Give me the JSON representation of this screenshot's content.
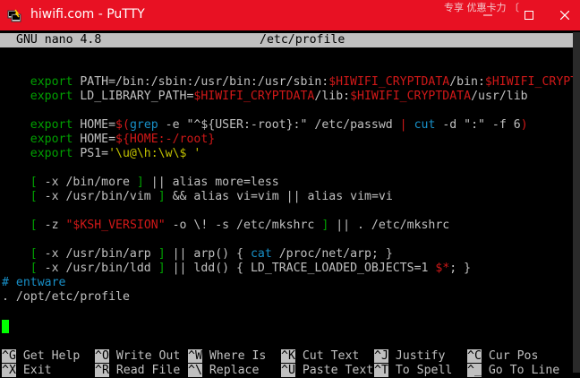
{
  "window": {
    "title": "hiwifi.com - PuTTY",
    "behind_text": "专享 优惠卡力 〔",
    "colors": {
      "titlebar": "#e81123",
      "terminal_bg": "#000000",
      "cursor": "#00ff00"
    }
  },
  "nano": {
    "version": "GNU nano 4.8",
    "filename": "/etc/profile"
  },
  "file": {
    "path_export": {
      "kw": "export",
      "var": " PATH=/bin:/sbin:/usr/bin:/usr/sbin:",
      "v1": "$HIWIFI_CRYPTDATA",
      "mid": "/bin:",
      "v2": "$HIWIFI_CRYPTDA",
      "more": ">"
    },
    "ld_export": {
      "kw": "export",
      "var": " LD_LIBRARY_PATH=",
      "v1": "$HIWIFI_CRYPTDATA",
      "mid": "/lib:",
      "v2": "$HIWIFI_CRYPTDATA",
      "tail": "/usr/lib"
    },
    "home1": {
      "kw": "export",
      "a": " HOME=",
      "b": "$(",
      "c": "grep",
      "d": " -e ",
      "e": "\"^${USER:-root}:\"",
      "f": " /etc/passwd ",
      "g": "|",
      "h": " cut",
      "i": " -d ",
      "j": "\":\"",
      "k": " -f 6",
      "l": ")"
    },
    "home2": {
      "kw": "export",
      "a": " HOME=",
      "b": "${HOME:-/root}"
    },
    "ps1": {
      "kw": "export",
      "a": " PS1=",
      "b": "'\\u@\\h:\\w\\$ '"
    },
    "more_line": {
      "a": "[",
      "b": " -x /bin/more ",
      "c": "]",
      "d": " || ",
      "e": "alias",
      "f": " more=less"
    },
    "vim_line": {
      "a": "[",
      "b": " -x /usr/bin/vim ",
      "c": "]",
      "d": " && ",
      "e": "alias",
      "f": " vi=vim ",
      "g": "||",
      "h": " alias",
      "i": " vim=vi"
    },
    "ksh_line": {
      "a": "[",
      "b": " -z ",
      "c": "\"$KSH_VERSION\"",
      "d": " -o \\! -s /etc/mkshrc ",
      "e": "]",
      "f": " || ",
      "g": ". /etc/mkshrc"
    },
    "arp_line": {
      "a": "[",
      "b": " -x /usr/bin/arp ",
      "c": "]",
      "d": " || ",
      "e": "arp() { ",
      "f": "cat",
      "g": " /proc/net/arp; ",
      "h": "}"
    },
    "ldd_line": {
      "a": "[",
      "b": " -x /usr/bin/ldd ",
      "c": "]",
      "d": " || ",
      "e": "ldd() { ",
      "f": "LD_TRACE_LOADED_OBJECTS=1 ",
      "g": "$*",
      "h": "; ",
      "i": "}"
    },
    "comment": "# entware",
    "source": ". /opt/etc/profile"
  },
  "shortcuts": [
    {
      "key": "^G",
      "label": " Get Help"
    },
    {
      "key": "^O",
      "label": " Write Out"
    },
    {
      "key": "^W",
      "label": " Where Is"
    },
    {
      "key": "^K",
      "label": " Cut Text"
    },
    {
      "key": "^J",
      "label": " Justify"
    },
    {
      "key": "^C",
      "label": " Cur Pos"
    },
    {
      "key": "^X",
      "label": " Exit"
    },
    {
      "key": "^R",
      "label": " Read File"
    },
    {
      "key": "^\\",
      "label": " Replace"
    },
    {
      "key": "^U",
      "label": " Paste Text"
    },
    {
      "key": "^T",
      "label": " To Spell"
    },
    {
      "key": "^_",
      "label": " Go To Line"
    }
  ]
}
